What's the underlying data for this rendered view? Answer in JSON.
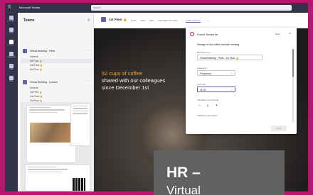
{
  "titlebar": {
    "app_name": "Microsoft Teams",
    "search_placeholder": "Search"
  },
  "rail": {
    "items": [
      {
        "label": "Activity"
      },
      {
        "label": "Chat"
      },
      {
        "label": "Teams"
      },
      {
        "label": "Calendar"
      },
      {
        "label": "Calls"
      },
      {
        "label": "Files"
      }
    ]
  },
  "teams_panel": {
    "title": "Teams",
    "teams": [
      {
        "name": "Virtual Building - Paris",
        "channels": [
          "General",
          "1st Floor 🔒",
          "2nd Floor 🔒",
          "3rd Floor 🔒"
        ]
      },
      {
        "name": "Virtual Building - London",
        "channels": [
          "General",
          "1st Floor 🔒",
          "2nd Floor 🔒",
          "3rd Floor 🔒"
        ]
      }
    ]
  },
  "main_header": {
    "channel_name": "1st Floor 🔒",
    "tabs": [
      "Posts",
      "Files",
      "Wiki",
      "Cold Water Fountain",
      "Coffee Machine"
    ]
  },
  "stat": {
    "count": "52 cups of coffee",
    "line2": "shared with our colleagues",
    "line3": "since December 1st"
  },
  "caption": {
    "line1": "HR –",
    "line2": "Virtual"
  },
  "dialog": {
    "title": "Poncif Teams for",
    "back": "Back",
    "close": "×",
    "subtitle": "Manage a new coffee machine meeting",
    "meeting_room_label": "Meeting room",
    "meeting_room_value": "Virtual Building - Paris - 1st Floor 🔒",
    "frequency_label": "Frequency",
    "frequency_value": "Frequency",
    "time_slot_label": "Time slot",
    "time_slot_value": "11:00",
    "attendees_label": "Attendees per meeting",
    "attendees_value": "5",
    "minus": "−",
    "plus": "+",
    "additional_label": "Additional description",
    "save": "Save"
  }
}
